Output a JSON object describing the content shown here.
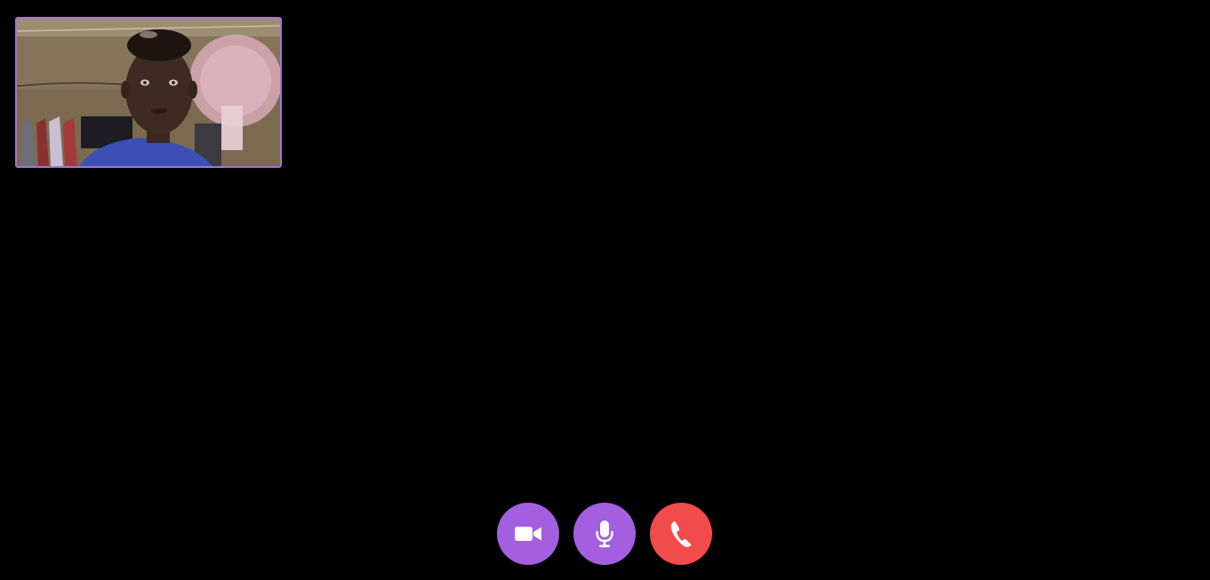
{
  "call": {
    "self_view": {
      "description_icon": "video-preview",
      "border_color": "#a86fe0"
    },
    "controls": [
      {
        "id": "video",
        "icon": "video-camera-icon",
        "color": "#a45ee0"
      },
      {
        "id": "mic",
        "icon": "microphone-icon",
        "color": "#a45ee0"
      },
      {
        "id": "end",
        "icon": "phone-hangup-icon",
        "color": "#f24b4b"
      }
    ]
  },
  "colors": {
    "background": "#000000",
    "accent": "#a45ee0",
    "danger": "#f24b4b"
  }
}
